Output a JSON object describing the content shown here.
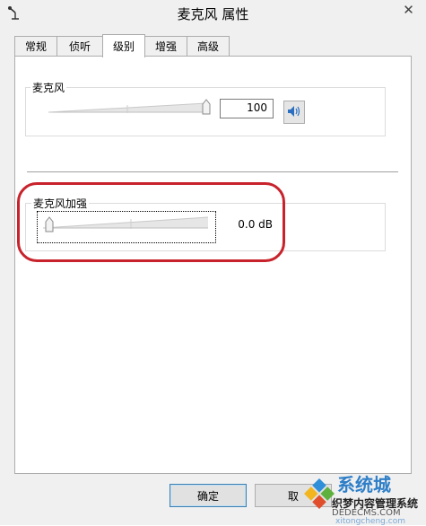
{
  "window": {
    "title": "麦克风 属性",
    "close_label": "✕"
  },
  "tabs": [
    {
      "label": "常规",
      "active": false
    },
    {
      "label": "侦听",
      "active": false
    },
    {
      "label": "级别",
      "active": true
    },
    {
      "label": "增强",
      "active": false
    },
    {
      "label": "高级",
      "active": false
    }
  ],
  "microphone": {
    "label": "麦克风",
    "level_value": "100",
    "level_fraction": 1.0,
    "speaker_icon": "speaker-icon"
  },
  "boost": {
    "label": "麦克风加强",
    "value": "0.0 dB",
    "level_fraction": 0.0
  },
  "buttons": {
    "ok": "确定",
    "cancel": "取"
  },
  "watermark": {
    "title": "系统城",
    "line1": "织梦内容管理系统",
    "line2": "DEDECMS.COM",
    "line3": "xitongcheng.com"
  },
  "colors": {
    "highlight": "#c8232c",
    "accent": "#3c7fb1"
  }
}
